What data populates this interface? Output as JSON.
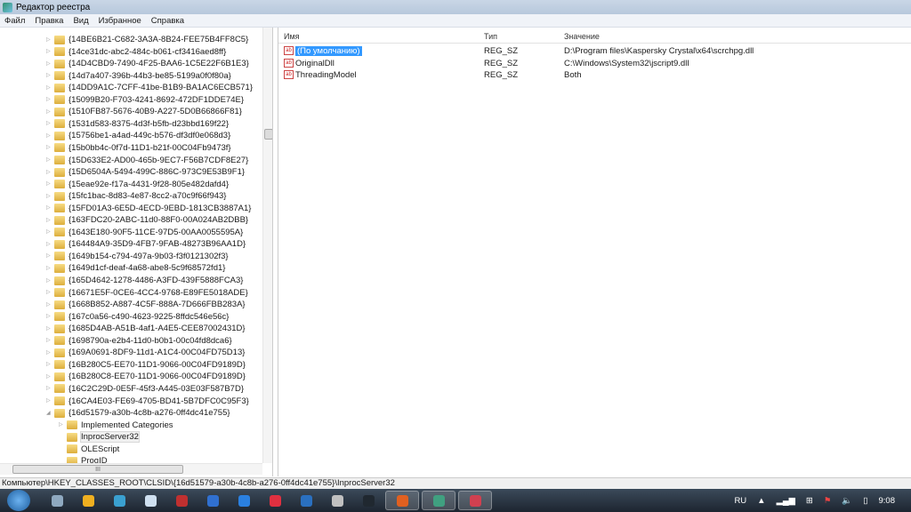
{
  "window": {
    "title": "Редактор реестра"
  },
  "menu": [
    "Файл",
    "Правка",
    "Вид",
    "Избранное",
    "Справка"
  ],
  "tree": {
    "keys": [
      "{14BE6B21-C682-3A3A-8B24-FEE75B4FF8C5}",
      "{14ce31dc-abc2-484c-b061-cf3416aed8ff}",
      "{14D4CBD9-7490-4F25-BAA6-1C5E22F6B1E3}",
      "{14d7a407-396b-44b3-be85-5199a0f0f80a}",
      "{14DD9A1C-7CFF-41be-B1B9-BA1AC6ECB571}",
      "{15099B20-F703-4241-8692-472DF1DDE74E}",
      "{1510FB87-5676-40B9-A227-5D0B66866F81}",
      "{1531d583-8375-4d3f-b5fb-d23bbd169f22}",
      "{15756be1-a4ad-449c-b576-df3df0e068d3}",
      "{15b0bb4c-0f7d-11D1-b21f-00C04Fb9473f}",
      "{15D633E2-AD00-465b-9EC7-F56B7CDF8E27}",
      "{15D6504A-5494-499C-886C-973C9E53B9F1}",
      "{15eae92e-f17a-4431-9f28-805e482dafd4}",
      "{15fc1bac-8d83-4e87-8cc2-a70c9f66f943}",
      "{15FD01A3-6E5D-4ECD-9EBD-1813CB3887A1}",
      "{163FDC20-2ABC-11d0-88F0-00A024AB2DBB}",
      "{1643E180-90F5-11CE-97D5-00AA0055595A}",
      "{164484A9-35D9-4FB7-9FAB-48273B96AA1D}",
      "{1649b154-c794-497a-9b03-f3f0121302f3}",
      "{1649d1cf-deaf-4a68-abe8-5c9f68572fd1}",
      "{165D4642-1278-4486-A3FD-439F5888FCA3}",
      "{16671E5F-0CE6-4CC4-9768-E89FE5018ADE}",
      "{1668B852-A887-4C5F-888A-7D666FBB283A}",
      "{167c0a56-c490-4623-9225-8ffdc546e56c}",
      "{1685D4AB-A51B-4af1-A4E5-CEE87002431D}",
      "{1698790a-e2b4-11d0-b0b1-00c04fd8dca6}",
      "{169A0691-8DF9-11d1-A1C4-00C04FD75D13}",
      "{16B280C5-EE70-11D1-9066-00C04FD9189D}",
      "{16B280C8-EE70-11D1-9066-00C04FD9189D}",
      "{16C2C29D-0E5F-45f3-A445-03E03F587B7D}",
      "{16CA4E03-FE69-4705-BD41-5B7DFC0C95F3}",
      "{16d51579-a30b-4c8b-a276-0ff4dc41e755}"
    ],
    "children": [
      "Implemented Categories",
      "InprocServer32",
      "OLEScript",
      "ProgID"
    ],
    "scroll_hint": "III"
  },
  "list": {
    "headers": {
      "name": "Имя",
      "type": "Тип",
      "value": "Значение"
    },
    "rows": [
      {
        "name": "(По умолчанию)",
        "type": "REG_SZ",
        "value": "D:\\Program files\\Kaspersky Crystal\\x64\\scrchpg.dll"
      },
      {
        "name": "OriginalDll",
        "type": "REG_SZ",
        "value": "C:\\Windows\\System32\\jscript9.dll"
      },
      {
        "name": "ThreadingModel",
        "type": "REG_SZ",
        "value": "Both"
      }
    ]
  },
  "status": "Компьютер\\HKEY_CLASSES_ROOT\\CLSID\\{16d51579-a30b-4c8b-a276-0ff4dc41e755}\\InprocServer32",
  "taskbar": {
    "apps": [
      "explorer",
      "outlook",
      "app3",
      "calculator",
      "app5",
      "app6",
      "internet-explorer",
      "itunes",
      "app9",
      "app10",
      "lightroom",
      "firefox",
      "regedit",
      "app14"
    ],
    "lang": "RU",
    "time": "9:08"
  },
  "colors": {
    "selection": "#3399ff",
    "taskbar": "#1d2530"
  }
}
